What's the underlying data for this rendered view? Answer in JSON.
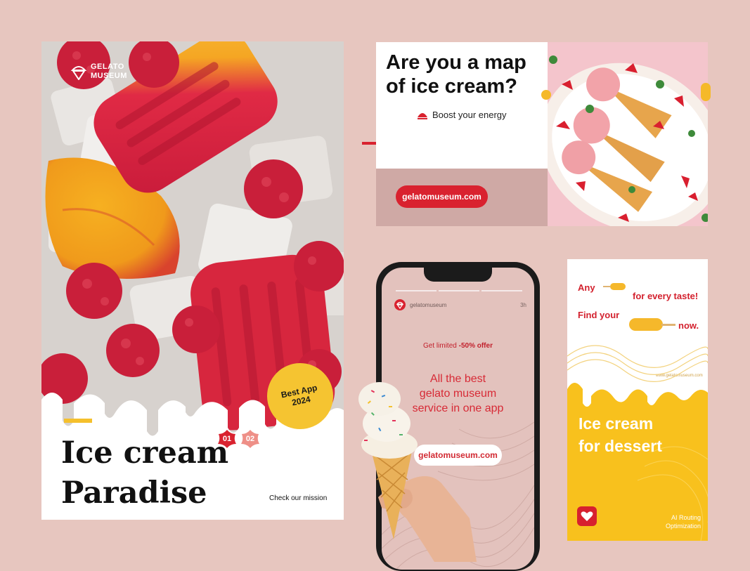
{
  "colors": {
    "background": "#e7c6bf",
    "red": "#d9222f",
    "yellow": "#f5c431",
    "pink": "#f2c9cf"
  },
  "poster": {
    "logo_line1": "GELATO",
    "logo_line2": "MUSEUM",
    "badge_line1": "Best App",
    "badge_line2": "2024",
    "number_1": "01",
    "number_2": "02",
    "title_line1": "Ice cream",
    "title_line2": "Paradise",
    "mission_link": "Check our mission"
  },
  "ad": {
    "title_line1": "Are you a map",
    "title_line2": "of ice cream?",
    "tagline": "Boost your energy",
    "url": "gelatomuseum.com"
  },
  "phone": {
    "app_name": "gelatomuseum",
    "time": "3h",
    "offer_prefix": "Get limited",
    "offer_value": "-50% offer",
    "service_line1": "All the best",
    "service_line2": "gelato museum",
    "service_line3": "service in one app",
    "url": "gelatomuseum.com"
  },
  "banner": {
    "any": "Any",
    "for_every_taste": "for every taste!",
    "find_your": "Find your",
    "now": "now.",
    "small_url": "www.gelatomuseum.com",
    "title_line1": "Ice cream",
    "title_line2": "for dessert",
    "ai_line1": "AI Routing",
    "ai_line2": "Optimization"
  },
  "icons": [
    "gelato-logo-icon",
    "cone-logo-icon",
    "heart-icon",
    "popsicle-icon",
    "flower-badge-icon"
  ]
}
